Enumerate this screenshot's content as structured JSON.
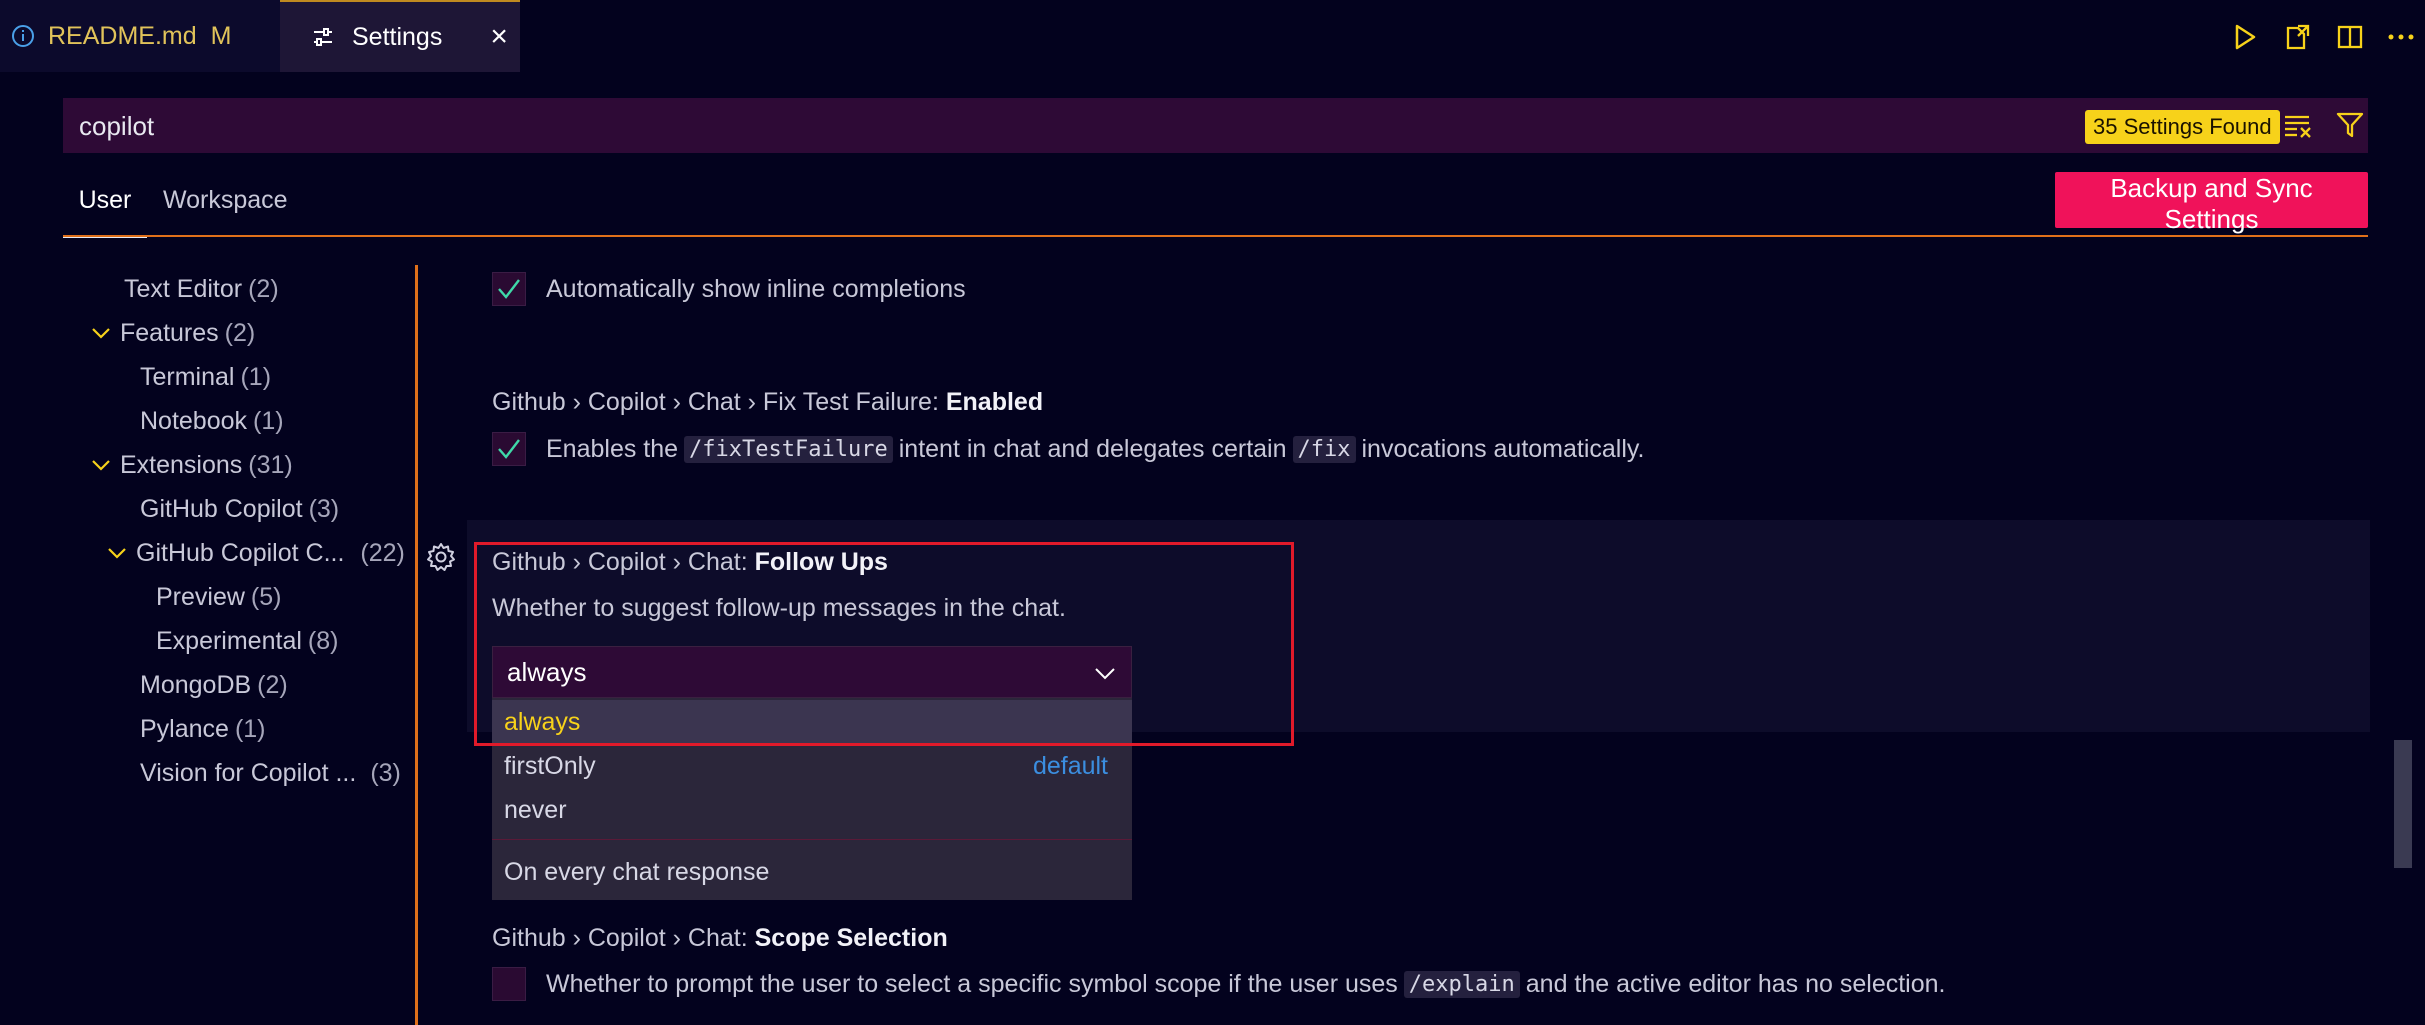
{
  "tabs": {
    "readme": {
      "label": "README.md",
      "flag": "M"
    },
    "settings": {
      "label": "Settings",
      "close": "×"
    }
  },
  "search": {
    "value": "copilot",
    "found_badge": "35 Settings Found"
  },
  "scope_tabs": {
    "user": "User",
    "workspace": "Workspace"
  },
  "sync_button": "Backup and Sync Settings",
  "toc": {
    "text_editor": {
      "label": "Text Editor",
      "count": "(2)"
    },
    "features": {
      "label": "Features",
      "count": "(2)"
    },
    "terminal": {
      "label": "Terminal",
      "count": "(1)"
    },
    "notebook": {
      "label": "Notebook",
      "count": "(1)"
    },
    "extensions": {
      "label": "Extensions",
      "count": "(31)"
    },
    "github_copilot": {
      "label": "GitHub Copilot",
      "count": "(3)"
    },
    "github_copilot_chat": {
      "label": "GitHub Copilot C...",
      "count": "(22)"
    },
    "preview": {
      "label": "Preview",
      "count": "(5)"
    },
    "experimental": {
      "label": "Experimental",
      "count": "(8)"
    },
    "mongodb": {
      "label": "MongoDB",
      "count": "(2)"
    },
    "pylance": {
      "label": "Pylance",
      "count": "(1)"
    },
    "vision": {
      "label": "Vision for Copilot ...",
      "count": "(3)"
    }
  },
  "settings": {
    "inline": {
      "description": "Automatically show inline completions",
      "checked": true
    },
    "fix_test": {
      "prefix": "Github › Copilot › Chat › Fix Test Failure: ",
      "name": "Enabled",
      "desc_1": "Enables the",
      "code_1": "/fixTestFailure",
      "desc_2": "intent in chat and delegates certain",
      "code_2": "/fix",
      "desc_3": "invocations automatically.",
      "checked": true
    },
    "follow_ups": {
      "prefix": "Github › Copilot › Chat: ",
      "name": "Follow Ups",
      "description": "Whether to suggest follow-up messages in the chat.",
      "value": "always",
      "options": [
        "always",
        "firstOnly",
        "never"
      ],
      "default_label": "default",
      "option_description": "On every chat response"
    },
    "scope_selection": {
      "prefix": "Github › Copilot › Chat: ",
      "name": "Scope Selection",
      "desc_1": "Whether to prompt the user to select a specific symbol scope if the user uses",
      "code_1": "/explain",
      "desc_2": "and the active editor has no selection.",
      "checked": false
    }
  },
  "colors": {
    "background": "#03021e",
    "accent_orange": "#e0701a",
    "badge_yellow": "#f7d21a",
    "sync_pink": "#f0125a",
    "highlight_red": "#e11a2a",
    "check_green": "#3fd8a8"
  }
}
